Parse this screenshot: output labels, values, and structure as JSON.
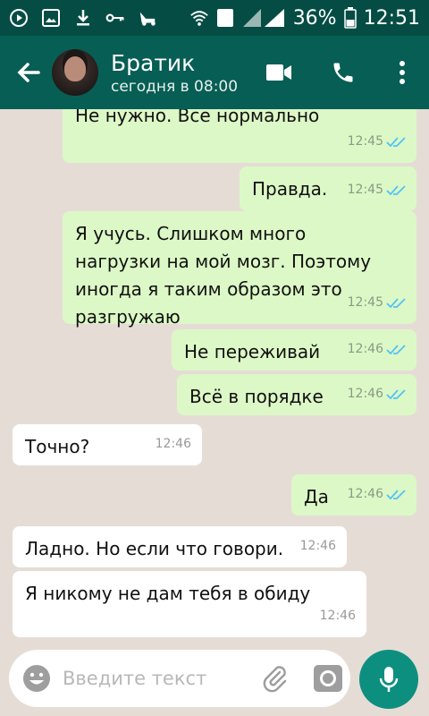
{
  "status_bar": {
    "battery": "36%",
    "time": "12:51",
    "sim": "2"
  },
  "header": {
    "name": "Братик",
    "last_seen": "сегодня в 08:00"
  },
  "messages": [
    {
      "dir": "out",
      "text": "Не нужно. Все нормально",
      "time": "12:45"
    },
    {
      "dir": "out",
      "text": "Правда.",
      "time": "12:45"
    },
    {
      "dir": "out",
      "text": "Я учусь. Слишком много нагрузки на мой мозг. Поэтому иногда я таким образом это разгружаю",
      "time": "12:45"
    },
    {
      "dir": "out",
      "text": "Не переживай",
      "time": "12:46"
    },
    {
      "dir": "out",
      "text": "Всё в порядке",
      "time": "12:46"
    },
    {
      "dir": "in",
      "text": "Точно?",
      "time": "12:46"
    },
    {
      "dir": "out",
      "text": "Да",
      "time": "12:46"
    },
    {
      "dir": "in",
      "text": "Ладно. Но если что говори.",
      "time": "12:46"
    },
    {
      "dir": "in",
      "text": "Я никому не дам тебя в обиду",
      "time": "12:46"
    }
  ],
  "input": {
    "placeholder": "Введите текст"
  },
  "colors": {
    "header": "#075e54",
    "status_bar": "#054d44",
    "outgoing": "#dcf8c6",
    "incoming": "#ffffff",
    "read_tick": "#4fc3f7",
    "mic": "#0d8f80"
  }
}
